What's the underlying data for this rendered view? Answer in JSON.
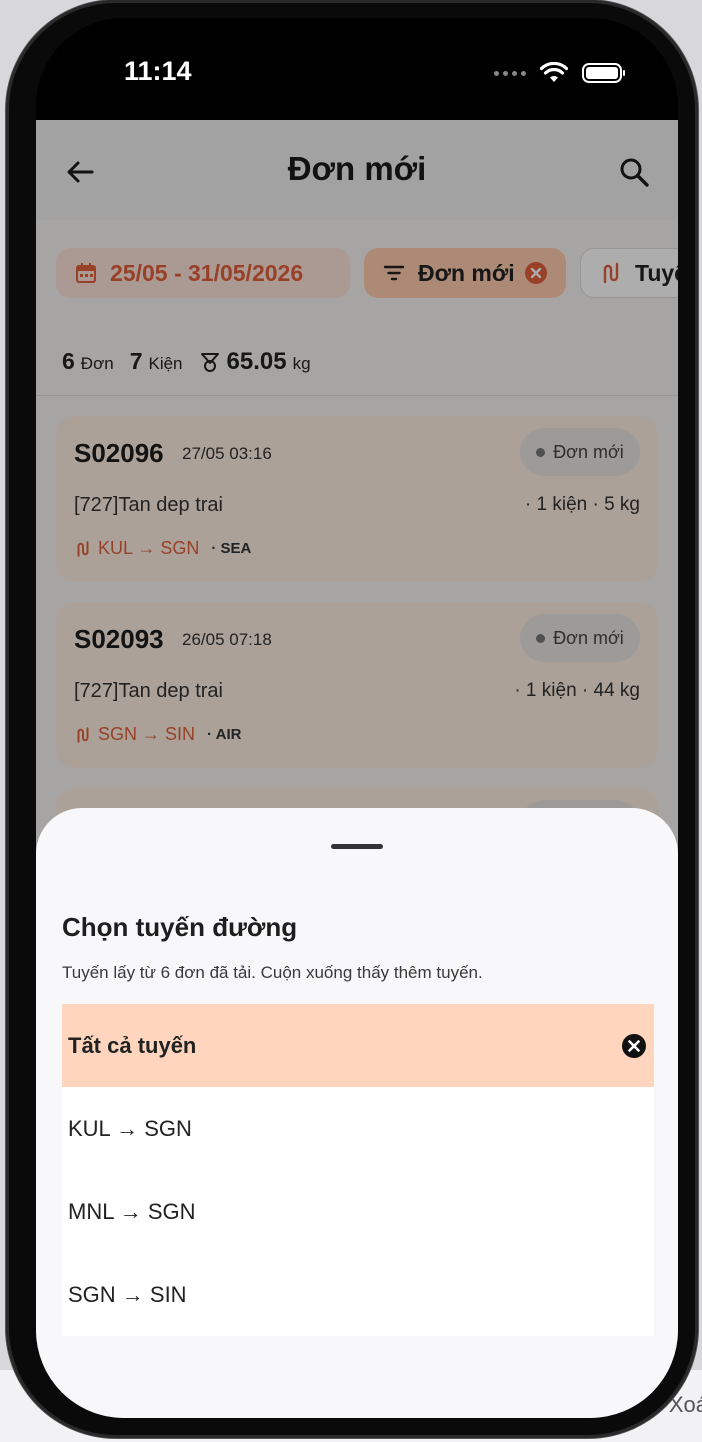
{
  "status_bar": {
    "time": "11:14"
  },
  "header": {
    "title": "Đơn mới"
  },
  "filters": {
    "date_range": "25/05 - 31/05/2026",
    "status": "Đơn mới",
    "route": "Tuyế"
  },
  "summary": {
    "orders_count": "6",
    "orders_unit": "Đơn",
    "packages_count": "7",
    "packages_unit": "Kiện",
    "weight": "65.05",
    "weight_unit": "kg"
  },
  "orders": [
    {
      "id": "S02096",
      "time": "27/05 03:16",
      "status": "Đơn mới",
      "customer": "[727]Tan dep trai",
      "qty": "· 1 kiện · 5 kg",
      "route": "KUL → SGN",
      "mode": "· SEA"
    },
    {
      "id": "S02093",
      "time": "26/05 07:18",
      "status": "Đơn mới",
      "customer": "[727]Tan dep trai",
      "qty": "· 1 kiện · 44 kg",
      "route": "SGN → SIN",
      "mode": "· AIR"
    }
  ],
  "sheet": {
    "title": "Chọn tuyến đường",
    "subtitle": "Tuyến lấy từ 6 đơn đã tải. Cuộn xuống thấy thêm tuyến.",
    "options": [
      {
        "label": "Tất cả tuyến",
        "selected": true
      },
      {
        "label": "KUL → SGN",
        "selected": false
      },
      {
        "label": "MNL → SGN",
        "selected": false
      },
      {
        "label": "SGN → SIN",
        "selected": false
      }
    ]
  },
  "backdrop": {
    "fragment_text": "Xoá"
  },
  "colors": {
    "accent": "#e0613b",
    "selected_bg": "#ffd6bd",
    "card_bg": "#fdeee1"
  }
}
